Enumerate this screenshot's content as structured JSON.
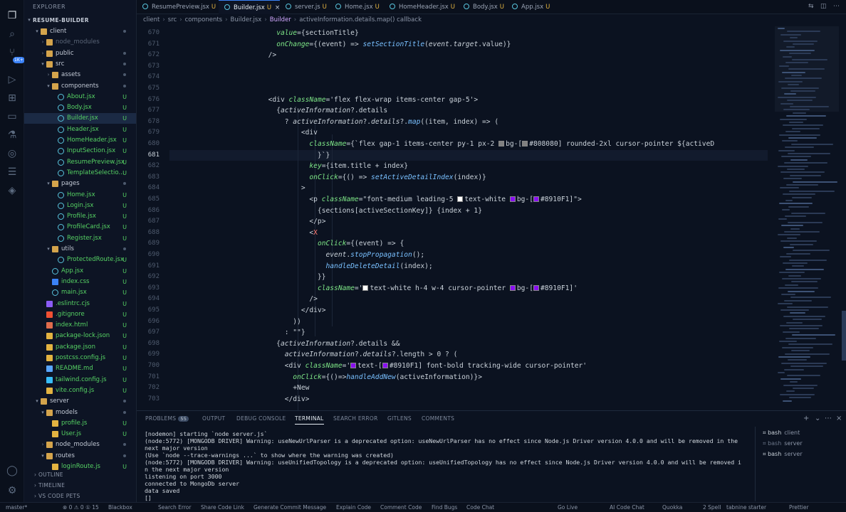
{
  "sidebar": {
    "title": "EXPLORER",
    "root": "RESUME-BUILDER",
    "tree": [
      {
        "label": "client",
        "depth": 1,
        "type": "folder",
        "open": true,
        "status": "dot"
      },
      {
        "label": "node_modules",
        "depth": 2,
        "type": "folder",
        "open": false,
        "dim": true
      },
      {
        "label": "public",
        "depth": 2,
        "type": "folder",
        "open": false,
        "status": "dot"
      },
      {
        "label": "src",
        "depth": 2,
        "type": "folder",
        "open": true,
        "status": "dot"
      },
      {
        "label": "assets",
        "depth": 3,
        "type": "folder",
        "open": false,
        "status": "dot"
      },
      {
        "label": "components",
        "depth": 3,
        "type": "folder",
        "open": true,
        "status": "dot"
      },
      {
        "label": "About.jsx",
        "depth": 4,
        "type": "react",
        "status": "U"
      },
      {
        "label": "Body.jsx",
        "depth": 4,
        "type": "react",
        "status": "U"
      },
      {
        "label": "Builder.jsx",
        "depth": 4,
        "type": "react",
        "status": "U",
        "selected": true
      },
      {
        "label": "Header.jsx",
        "depth": 4,
        "type": "react",
        "status": "U"
      },
      {
        "label": "HomeHeader.jsx",
        "depth": 4,
        "type": "react",
        "status": "U"
      },
      {
        "label": "InputSection.jsx",
        "depth": 4,
        "type": "react",
        "status": "U"
      },
      {
        "label": "ResumePreview.jsx",
        "depth": 4,
        "type": "react",
        "status": "U"
      },
      {
        "label": "TemplateSelectio...",
        "depth": 4,
        "type": "react",
        "status": "U"
      },
      {
        "label": "pages",
        "depth": 3,
        "type": "folder",
        "open": true,
        "status": "dot"
      },
      {
        "label": "Home.jsx",
        "depth": 4,
        "type": "react",
        "status": "U"
      },
      {
        "label": "Login.jsx",
        "depth": 4,
        "type": "react",
        "status": "U"
      },
      {
        "label": "Profile.jsx",
        "depth": 4,
        "type": "react",
        "status": "U"
      },
      {
        "label": "ProfileCard.jsx",
        "depth": 4,
        "type": "react",
        "status": "U"
      },
      {
        "label": "Register.jsx",
        "depth": 4,
        "type": "react",
        "status": "U"
      },
      {
        "label": "utils",
        "depth": 3,
        "type": "folder",
        "open": true,
        "status": "dot"
      },
      {
        "label": "ProtectedRoute.jsx",
        "depth": 4,
        "type": "react",
        "status": "U"
      },
      {
        "label": "App.jsx",
        "depth": 3,
        "type": "react",
        "status": "U"
      },
      {
        "label": "index.css",
        "depth": 3,
        "type": "css",
        "status": "U"
      },
      {
        "label": "main.jsx",
        "depth": 3,
        "type": "react",
        "status": "U"
      },
      {
        "label": ".eslintrc.cjs",
        "depth": 2,
        "type": "eslint",
        "status": "U"
      },
      {
        "label": ".gitignore",
        "depth": 2,
        "type": "git",
        "status": "U"
      },
      {
        "label": "index.html",
        "depth": 2,
        "type": "html",
        "status": "U"
      },
      {
        "label": "package-lock.json",
        "depth": 2,
        "type": "json",
        "status": "U"
      },
      {
        "label": "package.json",
        "depth": 2,
        "type": "json",
        "status": "U"
      },
      {
        "label": "postcss.config.js",
        "depth": 2,
        "type": "js",
        "status": "U"
      },
      {
        "label": "README.md",
        "depth": 2,
        "type": "md",
        "status": "U"
      },
      {
        "label": "tailwind.config.js",
        "depth": 2,
        "type": "tw",
        "status": "U"
      },
      {
        "label": "vite.config.js",
        "depth": 2,
        "type": "js",
        "status": "U"
      },
      {
        "label": "server",
        "depth": 1,
        "type": "folder",
        "open": true,
        "status": "dot"
      },
      {
        "label": "models",
        "depth": 2,
        "type": "folder",
        "open": true,
        "status": "dot"
      },
      {
        "label": "profile.js",
        "depth": 3,
        "type": "js",
        "status": "U"
      },
      {
        "label": "User.js",
        "depth": 3,
        "type": "js",
        "status": "U"
      },
      {
        "label": "node_modules",
        "depth": 2,
        "type": "folder",
        "open": false,
        "status": "dot"
      },
      {
        "label": "routes",
        "depth": 2,
        "type": "folder",
        "open": true,
        "status": "dot"
      },
      {
        "label": "loginRoute.js",
        "depth": 3,
        "type": "js",
        "status": "U"
      }
    ],
    "sections": [
      "OUTLINE",
      "TIMELINE",
      "VS CODE PETS"
    ]
  },
  "tabs": [
    {
      "label": "ResumePreview.jsx",
      "status": "U"
    },
    {
      "label": "Builder.jsx",
      "status": "U",
      "active": true
    },
    {
      "label": "server.js",
      "status": "U"
    },
    {
      "label": "Home.jsx",
      "status": "U"
    },
    {
      "label": "HomeHeader.jsx",
      "status": "U"
    },
    {
      "label": "Body.jsx",
      "status": "U"
    },
    {
      "label": "App.jsx",
      "status": "U"
    }
  ],
  "breadcrumb": [
    "client",
    "src",
    "components",
    "Builder.jsx",
    "Builder",
    "activeInformation.details.map() callback"
  ],
  "editor": {
    "current_line": 681,
    "lines": [
      {
        "n": 670,
        "indent": 0,
        "tokens": [
          [
            "pl",
            "                          "
          ],
          [
            "attr",
            "value"
          ],
          [
            "pl",
            "={sectionTitle}"
          ]
        ]
      },
      {
        "n": 671,
        "indent": 0,
        "tokens": [
          [
            "pl",
            "                          "
          ],
          [
            "attr",
            "onChange"
          ],
          [
            "pl",
            "={(event) => "
          ],
          [
            "fn",
            "setSectionTitle"
          ],
          [
            "pl",
            "("
          ],
          [
            "it",
            "event.target"
          ],
          [
            "pl",
            ".value)}"
          ]
        ]
      },
      {
        "n": 672,
        "indent": 0,
        "tokens": [
          [
            "pl",
            "                        />"
          ]
        ]
      },
      {
        "n": 673,
        "indent": 0,
        "tokens": []
      },
      {
        "n": 674,
        "indent": 0,
        "tokens": []
      },
      {
        "n": 675,
        "indent": 0,
        "tokens": []
      },
      {
        "n": 676,
        "indent": 0,
        "tokens": [
          [
            "pl",
            "                        <div "
          ],
          [
            "attr",
            "className"
          ],
          [
            "pl",
            "='flex flex-wrap items-center gap-5'>"
          ]
        ]
      },
      {
        "n": 677,
        "indent": 0,
        "tokens": [
          [
            "pl",
            "                          {"
          ],
          [
            "it",
            "activeInformation"
          ],
          [
            "pl",
            "?.details"
          ]
        ]
      },
      {
        "n": 678,
        "indent": 0,
        "tokens": [
          [
            "pl",
            "                            ? "
          ],
          [
            "it",
            "activeInformation"
          ],
          [
            "pl",
            "?."
          ],
          [
            "it",
            "details"
          ],
          [
            "pl",
            "?."
          ],
          [
            "fn",
            "map"
          ],
          [
            "pl",
            "((item, index) => ("
          ]
        ]
      },
      {
        "n": 679,
        "indent": 0,
        "tokens": [
          [
            "pl",
            "                                <div"
          ]
        ]
      },
      {
        "n": 680,
        "indent": 0,
        "tokens": [
          [
            "pl",
            "                                  "
          ],
          [
            "attr",
            "className"
          ],
          [
            "pl",
            "={`flex gap-1 items-center py-1 px-2 "
          ],
          [
            "sw",
            "#808080"
          ],
          [
            "pl",
            "bg-["
          ],
          [
            "sw",
            "#808080"
          ],
          [
            "pl",
            "#808080] rounded-2xl cursor-pointer ${activeD"
          ]
        ]
      },
      {
        "n": 681,
        "indent": 0,
        "tokens": [
          [
            "pl",
            "                                    }`}"
          ]
        ]
      },
      {
        "n": 682,
        "indent": 0,
        "tokens": [
          [
            "pl",
            "                                  "
          ],
          [
            "attr",
            "key"
          ],
          [
            "pl",
            "={item.title + index}"
          ]
        ]
      },
      {
        "n": 683,
        "indent": 0,
        "tokens": [
          [
            "pl",
            "                                  "
          ],
          [
            "attr",
            "onClick"
          ],
          [
            "pl",
            "={() => "
          ],
          [
            "fn",
            "setActiveDetailIndex"
          ],
          [
            "pl",
            "(index)}"
          ]
        ]
      },
      {
        "n": 684,
        "indent": 0,
        "tokens": [
          [
            "pl",
            "                                >"
          ]
        ]
      },
      {
        "n": 685,
        "indent": 0,
        "tokens": [
          [
            "pl",
            "                                  <p "
          ],
          [
            "attr",
            "className"
          ],
          [
            "pl",
            "=\"font-medium leading-5 "
          ],
          [
            "sw",
            "#ffffff"
          ],
          [
            "pl",
            "text-white "
          ],
          [
            "sw",
            "#8910F1"
          ],
          [
            "pl",
            "bg-["
          ],
          [
            "sw",
            "#8910F1"
          ],
          [
            "pl",
            "#8910F1]\">"
          ]
        ]
      },
      {
        "n": 686,
        "indent": 0,
        "tokens": [
          [
            "pl",
            "                                    {sections[activeSectionKey]} {index + 1}"
          ]
        ]
      },
      {
        "n": 687,
        "indent": 0,
        "tokens": [
          [
            "pl",
            "                                  </p>"
          ]
        ]
      },
      {
        "n": 688,
        "indent": 0,
        "tokens": [
          [
            "pl",
            "                                  <"
          ],
          [
            "op",
            "X"
          ]
        ]
      },
      {
        "n": 689,
        "indent": 0,
        "tokens": [
          [
            "pl",
            "                                    "
          ],
          [
            "attr",
            "onClick"
          ],
          [
            "pl",
            "={(event) => {"
          ]
        ]
      },
      {
        "n": 690,
        "indent": 0,
        "tokens": [
          [
            "pl",
            "                                      "
          ],
          [
            "it",
            "event"
          ],
          [
            "pl",
            "."
          ],
          [
            "fn",
            "stopPropagation"
          ],
          [
            "pl",
            "();"
          ]
        ]
      },
      {
        "n": 691,
        "indent": 0,
        "tokens": [
          [
            "pl",
            "                                      "
          ],
          [
            "fn",
            "handleDeleteDetail"
          ],
          [
            "pl",
            "(index);"
          ]
        ]
      },
      {
        "n": 692,
        "indent": 0,
        "tokens": [
          [
            "pl",
            "                                    }}"
          ]
        ]
      },
      {
        "n": 693,
        "indent": 0,
        "tokens": [
          [
            "pl",
            "                                    "
          ],
          [
            "attr",
            "className"
          ],
          [
            "pl",
            "='"
          ],
          [
            "sw",
            "#ffffff"
          ],
          [
            "pl",
            "text-white h-4 w-4 cursor-pointer "
          ],
          [
            "sw",
            "#8910F1"
          ],
          [
            "pl",
            "bg-["
          ],
          [
            "sw",
            "#8910F1"
          ],
          [
            "pl",
            "#8910F1]'"
          ]
        ]
      },
      {
        "n": 694,
        "indent": 0,
        "tokens": [
          [
            "pl",
            "                                  />"
          ]
        ]
      },
      {
        "n": 695,
        "indent": 0,
        "tokens": [
          [
            "pl",
            "                                </div>"
          ]
        ]
      },
      {
        "n": 696,
        "indent": 0,
        "tokens": [
          [
            "pl",
            "                              ))"
          ]
        ]
      },
      {
        "n": 697,
        "indent": 0,
        "tokens": [
          [
            "pl",
            "                            : \"\"}"
          ]
        ]
      },
      {
        "n": 698,
        "indent": 0,
        "tokens": [
          [
            "pl",
            "                          {"
          ],
          [
            "it",
            "activeInformation"
          ],
          [
            "pl",
            "?.details &&"
          ]
        ]
      },
      {
        "n": 699,
        "indent": 0,
        "tokens": [
          [
            "pl",
            "                            "
          ],
          [
            "it",
            "activeInformation"
          ],
          [
            "pl",
            "?."
          ],
          [
            "it",
            "details"
          ],
          [
            "pl",
            "?.length > 0 ? ("
          ]
        ]
      },
      {
        "n": 700,
        "indent": 0,
        "tokens": [
          [
            "pl",
            "                            <div "
          ],
          [
            "attr",
            "className"
          ],
          [
            "pl",
            "='"
          ],
          [
            "sw",
            "#8910F1"
          ],
          [
            "pl",
            "text-["
          ],
          [
            "sw",
            "#8910F1"
          ],
          [
            "pl",
            "#8910F1] font-bold tracking-wide cursor-pointer'"
          ]
        ]
      },
      {
        "n": 701,
        "indent": 0,
        "tokens": [
          [
            "pl",
            "                              "
          ],
          [
            "attr",
            "onClick"
          ],
          [
            "pl",
            "={()=>"
          ],
          [
            "fn",
            "handleAddNew"
          ],
          [
            "pl",
            "(activeInformation)}>"
          ]
        ]
      },
      {
        "n": 702,
        "indent": 0,
        "tokens": [
          [
            "pl",
            "                              +New"
          ]
        ]
      },
      {
        "n": 703,
        "indent": 0,
        "tokens": [
          [
            "pl",
            "                            </div>"
          ]
        ]
      }
    ]
  },
  "panel": {
    "tabs": [
      {
        "label": "PROBLEMS",
        "badge": "55"
      },
      {
        "label": "OUTPUT"
      },
      {
        "label": "DEBUG CONSOLE"
      },
      {
        "label": "TERMINAL",
        "active": true
      },
      {
        "label": "SEARCH ERROR"
      },
      {
        "label": "GITLENS"
      },
      {
        "label": "COMMENTS"
      }
    ],
    "terminal_lines": [
      "[nodemon] starting `node server.js`",
      "(node:5772) [MONGODB DRIVER] Warning: useNewUrlParser is a deprecated option: useNewUrlParser has no effect since Node.js Driver version 4.0.0 and will be removed in the",
      "next major version",
      "(Use `node --trace-warnings ...` to show where the warning was created)",
      "(node:5772) [MONGODB DRIVER] Warning: useUnifiedTopology is a deprecated option: useUnifiedTopology has no effect since Node.js Driver version 4.0.0 and will be removed i",
      "n the next major version",
      "listening on port 3000",
      "connected to MongoDb server",
      "data saved",
      "[]"
    ],
    "terminals": [
      {
        "shell": "bash",
        "name": "client"
      },
      {
        "shell": "bash",
        "name": "server",
        "dim": true
      },
      {
        "shell": "bash",
        "name": "server"
      }
    ]
  },
  "statusbar": {
    "left": [
      "master*",
      "⊗ 0 ⚠ 0 ① 15",
      "Blackbox",
      "Search Error",
      "Share Code Link",
      "Generate Commit Message",
      "Explain Code",
      "Comment Code",
      "Find Bugs",
      "Code Chat"
    ],
    "right": [
      "Go Live",
      "AI Code Chat",
      "Quokka",
      "2 Spell",
      "tabnine starter",
      "Prettier"
    ]
  }
}
